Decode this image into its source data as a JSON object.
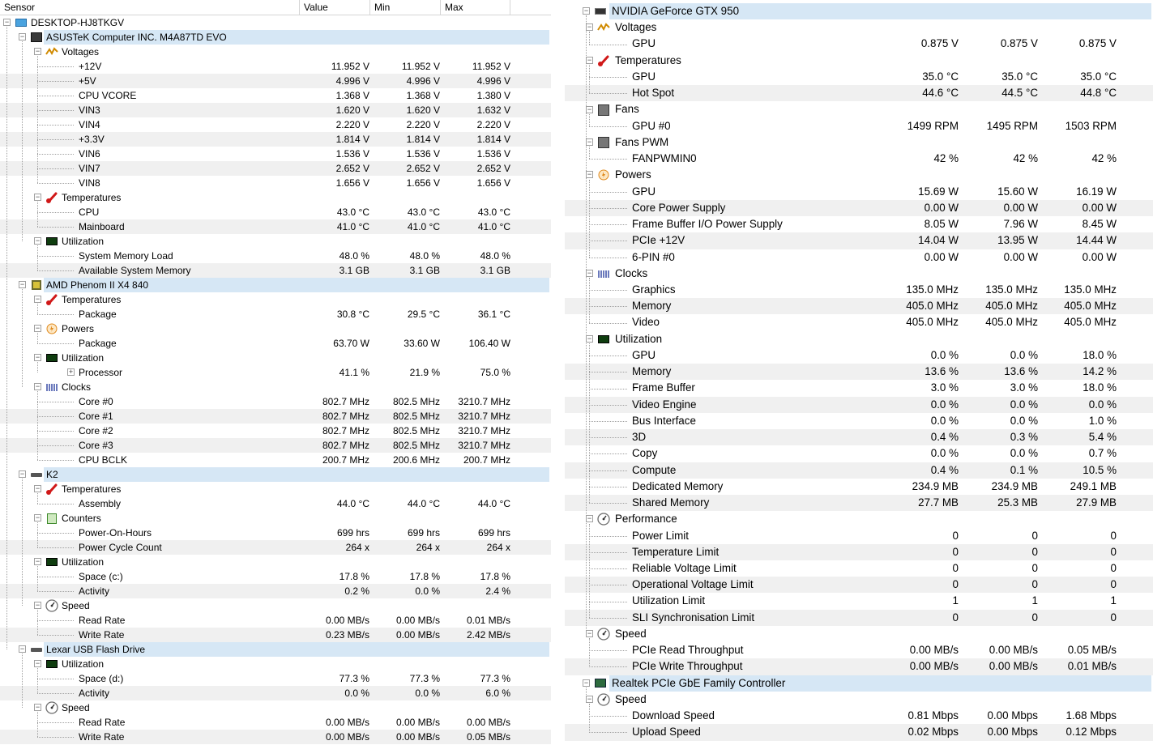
{
  "columns": {
    "sensor": "Sensor",
    "value": "Value",
    "min": "Min",
    "max": "Max"
  },
  "colors": {
    "highlight": "#d6e7f5",
    "alt_row": "#f0f0f0",
    "tree_line": "#a0a0a0"
  },
  "left_rows": [
    {
      "lvl": 0,
      "exp": "-",
      "icon": "monitor-icon",
      "label": "DESKTOP-HJ8TKGV"
    },
    {
      "lvl": 1,
      "exp": "-",
      "icon": "motherboard-icon",
      "label": "ASUSTeK Computer INC. M4A87TD EVO",
      "hl": true
    },
    {
      "lvl": 2,
      "exp": "-",
      "icon": "voltage-icon",
      "label": "Voltages"
    },
    {
      "lvl": 3,
      "label": "+12V",
      "value": "11.952 V",
      "min": "11.952 V",
      "max": "11.952 V"
    },
    {
      "lvl": 3,
      "label": "+5V",
      "value": "4.996 V",
      "min": "4.996 V",
      "max": "4.996 V"
    },
    {
      "lvl": 3,
      "label": "CPU VCORE",
      "value": "1.368 V",
      "min": "1.368 V",
      "max": "1.380 V"
    },
    {
      "lvl": 3,
      "label": "VIN3",
      "value": "1.620 V",
      "min": "1.620 V",
      "max": "1.632 V"
    },
    {
      "lvl": 3,
      "label": "VIN4",
      "value": "2.220 V",
      "min": "2.220 V",
      "max": "2.220 V"
    },
    {
      "lvl": 3,
      "label": "+3.3V",
      "value": "1.814 V",
      "min": "1.814 V",
      "max": "1.814 V"
    },
    {
      "lvl": 3,
      "label": "VIN6",
      "value": "1.536 V",
      "min": "1.536 V",
      "max": "1.536 V"
    },
    {
      "lvl": 3,
      "label": "VIN7",
      "value": "2.652 V",
      "min": "2.652 V",
      "max": "2.652 V"
    },
    {
      "lvl": 3,
      "label": "VIN8",
      "value": "1.656 V",
      "min": "1.656 V",
      "max": "1.656 V"
    },
    {
      "lvl": 2,
      "exp": "-",
      "icon": "thermometer-icon",
      "label": "Temperatures"
    },
    {
      "lvl": 3,
      "label": "CPU",
      "value": "43.0 °C",
      "min": "43.0 °C",
      "max": "43.0 °C"
    },
    {
      "lvl": 3,
      "label": "Mainboard",
      "value": "41.0 °C",
      "min": "41.0 °C",
      "max": "41.0 °C"
    },
    {
      "lvl": 2,
      "exp": "-",
      "icon": "utilization-icon",
      "label": "Utilization"
    },
    {
      "lvl": 3,
      "label": "System Memory Load",
      "value": "48.0 %",
      "min": "48.0 %",
      "max": "48.0 %"
    },
    {
      "lvl": 3,
      "label": "Available System Memory",
      "value": "3.1 GB",
      "min": "3.1 GB",
      "max": "3.1 GB"
    },
    {
      "lvl": 1,
      "exp": "-",
      "icon": "cpu-icon",
      "label": "AMD Phenom II X4 840",
      "hl": true
    },
    {
      "lvl": 2,
      "exp": "-",
      "icon": "thermometer-icon",
      "label": "Temperatures"
    },
    {
      "lvl": 3,
      "label": "Package",
      "value": "30.8 °C",
      "min": "29.5 °C",
      "max": "36.1 °C"
    },
    {
      "lvl": 2,
      "exp": "-",
      "icon": "power-icon",
      "label": "Powers"
    },
    {
      "lvl": 3,
      "label": "Package",
      "value": "63.70 W",
      "min": "33.60 W",
      "max": "106.40 W"
    },
    {
      "lvl": 2,
      "exp": "-",
      "icon": "utilization-icon",
      "label": "Utilization"
    },
    {
      "lvl": 3,
      "exp": "+",
      "label": "Processor",
      "value": "41.1 %",
      "min": "21.9 %",
      "max": "75.0 %"
    },
    {
      "lvl": 2,
      "exp": "-",
      "icon": "clock-icon",
      "label": "Clocks"
    },
    {
      "lvl": 3,
      "label": "Core #0",
      "value": "802.7 MHz",
      "min": "802.5 MHz",
      "max": "3210.7 MHz"
    },
    {
      "lvl": 3,
      "label": "Core #1",
      "value": "802.7 MHz",
      "min": "802.5 MHz",
      "max": "3210.7 MHz"
    },
    {
      "lvl": 3,
      "label": "Core #2",
      "value": "802.7 MHz",
      "min": "802.5 MHz",
      "max": "3210.7 MHz"
    },
    {
      "lvl": 3,
      "label": "Core #3",
      "value": "802.7 MHz",
      "min": "802.5 MHz",
      "max": "3210.7 MHz"
    },
    {
      "lvl": 3,
      "label": "CPU BCLK",
      "value": "200.7 MHz",
      "min": "200.6 MHz",
      "max": "200.7 MHz"
    },
    {
      "lvl": 1,
      "exp": "-",
      "icon": "drive-icon",
      "label": "K2",
      "hl": true
    },
    {
      "lvl": 2,
      "exp": "-",
      "icon": "thermometer-icon",
      "label": "Temperatures"
    },
    {
      "lvl": 3,
      "label": "Assembly",
      "value": "44.0 °C",
      "min": "44.0 °C",
      "max": "44.0 °C"
    },
    {
      "lvl": 2,
      "exp": "-",
      "icon": "counter-icon",
      "label": "Counters"
    },
    {
      "lvl": 3,
      "label": "Power-On-Hours",
      "value": "699 hrs",
      "min": "699 hrs",
      "max": "699 hrs"
    },
    {
      "lvl": 3,
      "label": "Power Cycle Count",
      "value": "264 x",
      "min": "264 x",
      "max": "264 x"
    },
    {
      "lvl": 2,
      "exp": "-",
      "icon": "utilization-icon",
      "label": "Utilization"
    },
    {
      "lvl": 3,
      "label": "Space (c:)",
      "value": "17.8 %",
      "min": "17.8 %",
      "max": "17.8 %"
    },
    {
      "lvl": 3,
      "label": "Activity",
      "value": "0.2 %",
      "min": "0.0 %",
      "max": "2.4 %"
    },
    {
      "lvl": 2,
      "exp": "-",
      "icon": "speed-icon",
      "label": "Speed"
    },
    {
      "lvl": 3,
      "label": "Read Rate",
      "value": "0.00 MB/s",
      "min": "0.00 MB/s",
      "max": "0.01 MB/s"
    },
    {
      "lvl": 3,
      "label": "Write Rate",
      "value": "0.23 MB/s",
      "min": "0.00 MB/s",
      "max": "2.42 MB/s"
    },
    {
      "lvl": 1,
      "exp": "-",
      "icon": "drive-icon",
      "label": "Lexar    USB Flash Drive",
      "hl": true
    },
    {
      "lvl": 2,
      "exp": "-",
      "icon": "utilization-icon",
      "label": "Utilization"
    },
    {
      "lvl": 3,
      "label": "Space (d:)",
      "value": "77.3 %",
      "min": "77.3 %",
      "max": "77.3 %"
    },
    {
      "lvl": 3,
      "label": "Activity",
      "value": "0.0 %",
      "min": "0.0 %",
      "max": "6.0 %"
    },
    {
      "lvl": 2,
      "exp": "-",
      "icon": "speed-icon",
      "label": "Speed"
    },
    {
      "lvl": 3,
      "label": "Read Rate",
      "value": "0.00 MB/s",
      "min": "0.00 MB/s",
      "max": "0.00 MB/s"
    },
    {
      "lvl": 3,
      "label": "Write Rate",
      "value": "0.00 MB/s",
      "min": "0.00 MB/s",
      "max": "0.05 MB/s"
    }
  ],
  "right_rows": [
    {
      "lvl": 1,
      "exp": "-",
      "icon": "gpu-icon",
      "label": "NVIDIA GeForce GTX 950",
      "hl": true
    },
    {
      "lvl": 2,
      "exp": "-",
      "icon": "voltage-icon",
      "label": "Voltages"
    },
    {
      "lvl": 3,
      "label": "GPU",
      "value": "0.875 V",
      "min": "0.875 V",
      "max": "0.875 V"
    },
    {
      "lvl": 2,
      "exp": "-",
      "icon": "thermometer-icon",
      "label": "Temperatures"
    },
    {
      "lvl": 3,
      "label": "GPU",
      "value": "35.0 °C",
      "min": "35.0 °C",
      "max": "35.0 °C"
    },
    {
      "lvl": 3,
      "label": "Hot Spot",
      "value": "44.6 °C",
      "min": "44.5 °C",
      "max": "44.8 °C"
    },
    {
      "lvl": 2,
      "exp": "-",
      "icon": "fan-icon",
      "label": "Fans"
    },
    {
      "lvl": 3,
      "label": "GPU #0",
      "value": "1499 RPM",
      "min": "1495 RPM",
      "max": "1503 RPM"
    },
    {
      "lvl": 2,
      "exp": "-",
      "icon": "fan-icon",
      "label": "Fans PWM"
    },
    {
      "lvl": 3,
      "label": "FANPWMIN0",
      "value": "42 %",
      "min": "42 %",
      "max": "42 %"
    },
    {
      "lvl": 2,
      "exp": "-",
      "icon": "power-icon",
      "label": "Powers"
    },
    {
      "lvl": 3,
      "label": "GPU",
      "value": "15.69 W",
      "min": "15.60 W",
      "max": "16.19 W"
    },
    {
      "lvl": 3,
      "label": "Core Power Supply",
      "value": "0.00 W",
      "min": "0.00 W",
      "max": "0.00 W"
    },
    {
      "lvl": 3,
      "label": "Frame Buffer I/O Power Supply",
      "value": "8.05 W",
      "min": "7.96 W",
      "max": "8.45 W"
    },
    {
      "lvl": 3,
      "label": "PCIe +12V",
      "value": "14.04 W",
      "min": "13.95 W",
      "max": "14.44 W"
    },
    {
      "lvl": 3,
      "label": "6-PIN #0",
      "value": "0.00 W",
      "min": "0.00 W",
      "max": "0.00 W"
    },
    {
      "lvl": 2,
      "exp": "-",
      "icon": "clock-icon",
      "label": "Clocks"
    },
    {
      "lvl": 3,
      "label": "Graphics",
      "value": "135.0 MHz",
      "min": "135.0 MHz",
      "max": "135.0 MHz"
    },
    {
      "lvl": 3,
      "label": "Memory",
      "value": "405.0 MHz",
      "min": "405.0 MHz",
      "max": "405.0 MHz"
    },
    {
      "lvl": 3,
      "label": "Video",
      "value": "405.0 MHz",
      "min": "405.0 MHz",
      "max": "405.0 MHz"
    },
    {
      "lvl": 2,
      "exp": "-",
      "icon": "utilization-icon",
      "label": "Utilization"
    },
    {
      "lvl": 3,
      "label": "GPU",
      "value": "0.0 %",
      "min": "0.0 %",
      "max": "18.0 %"
    },
    {
      "lvl": 3,
      "label": "Memory",
      "value": "13.6 %",
      "min": "13.6 %",
      "max": "14.2 %"
    },
    {
      "lvl": 3,
      "label": "Frame Buffer",
      "value": "3.0 %",
      "min": "3.0 %",
      "max": "18.0 %"
    },
    {
      "lvl": 3,
      "label": "Video Engine",
      "value": "0.0 %",
      "min": "0.0 %",
      "max": "0.0 %"
    },
    {
      "lvl": 3,
      "label": "Bus Interface",
      "value": "0.0 %",
      "min": "0.0 %",
      "max": "1.0 %"
    },
    {
      "lvl": 3,
      "label": "3D",
      "value": "0.4 %",
      "min": "0.3 %",
      "max": "5.4 %"
    },
    {
      "lvl": 3,
      "label": "Copy",
      "value": "0.0 %",
      "min": "0.0 %",
      "max": "0.7 %"
    },
    {
      "lvl": 3,
      "label": "Compute",
      "value": "0.4 %",
      "min": "0.1 %",
      "max": "10.5 %"
    },
    {
      "lvl": 3,
      "label": "Dedicated Memory",
      "value": "234.9 MB",
      "min": "234.9 MB",
      "max": "249.1 MB"
    },
    {
      "lvl": 3,
      "label": "Shared Memory",
      "value": "27.7 MB",
      "min": "25.3 MB",
      "max": "27.9 MB"
    },
    {
      "lvl": 2,
      "exp": "-",
      "icon": "speed-icon",
      "label": "Performance"
    },
    {
      "lvl": 3,
      "label": "Power Limit",
      "value": "0",
      "min": "0",
      "max": "0"
    },
    {
      "lvl": 3,
      "label": "Temperature Limit",
      "value": "0",
      "min": "0",
      "max": "0"
    },
    {
      "lvl": 3,
      "label": "Reliable Voltage Limit",
      "value": "0",
      "min": "0",
      "max": "0"
    },
    {
      "lvl": 3,
      "label": "Operational Voltage Limit",
      "value": "0",
      "min": "0",
      "max": "0"
    },
    {
      "lvl": 3,
      "label": "Utilization Limit",
      "value": "1",
      "min": "1",
      "max": "1"
    },
    {
      "lvl": 3,
      "label": "SLI Synchronisation Limit",
      "value": "0",
      "min": "0",
      "max": "0"
    },
    {
      "lvl": 2,
      "exp": "-",
      "icon": "speed-icon",
      "label": "Speed"
    },
    {
      "lvl": 3,
      "label": "PCIe Read Throughput",
      "value": "0.00 MB/s",
      "min": "0.00 MB/s",
      "max": "0.05 MB/s"
    },
    {
      "lvl": 3,
      "label": "PCIe Write Throughput",
      "value": "0.00 MB/s",
      "min": "0.00 MB/s",
      "max": "0.01 MB/s"
    },
    {
      "lvl": 1,
      "exp": "-",
      "icon": "nic-icon",
      "label": "Realtek PCIe GbE Family Controller",
      "hl": true
    },
    {
      "lvl": 2,
      "exp": "-",
      "icon": "speed-icon",
      "label": "Speed"
    },
    {
      "lvl": 3,
      "label": "Download Speed",
      "value": "0.81 Mbps",
      "min": "0.00 Mbps",
      "max": "1.68 Mbps"
    },
    {
      "lvl": 3,
      "label": "Upload Speed",
      "value": "0.02 Mbps",
      "min": "0.00 Mbps",
      "max": "0.12 Mbps"
    }
  ]
}
